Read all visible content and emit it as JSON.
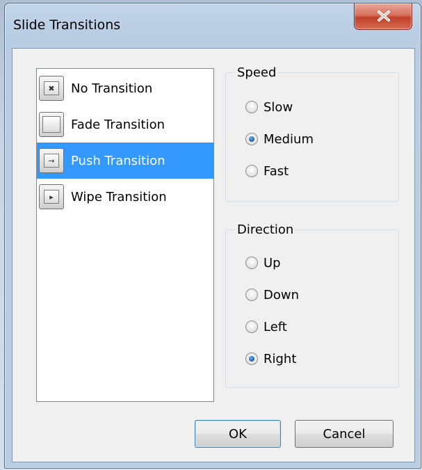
{
  "window": {
    "title": "Slide Transitions",
    "close_icon": "close-x-icon"
  },
  "transitions": {
    "items": [
      {
        "label": "No Transition",
        "icon": "no-transition-icon",
        "glyph": "✖",
        "selected": false
      },
      {
        "label": "Fade Transition",
        "icon": "fade-transition-icon",
        "glyph": "",
        "selected": false
      },
      {
        "label": "Push Transition",
        "icon": "push-transition-icon",
        "glyph": "→",
        "selected": true
      },
      {
        "label": "Wipe Transition",
        "icon": "wipe-transition-icon",
        "glyph": "▸",
        "selected": false
      }
    ]
  },
  "speed": {
    "legend": "Speed",
    "options": [
      {
        "label": "Slow",
        "checked": false
      },
      {
        "label": "Medium",
        "checked": true
      },
      {
        "label": "Fast",
        "checked": false
      }
    ]
  },
  "direction": {
    "legend": "Direction",
    "options": [
      {
        "label": "Up",
        "checked": false
      },
      {
        "label": "Down",
        "checked": false
      },
      {
        "label": "Left",
        "checked": false
      },
      {
        "label": "Right",
        "checked": true
      }
    ]
  },
  "buttons": {
    "ok_label": "OK",
    "cancel_label": "Cancel"
  },
  "colors": {
    "selection": "#3399ff",
    "radio_checked": "#1b5aa6",
    "close_button": "#c0402a"
  }
}
